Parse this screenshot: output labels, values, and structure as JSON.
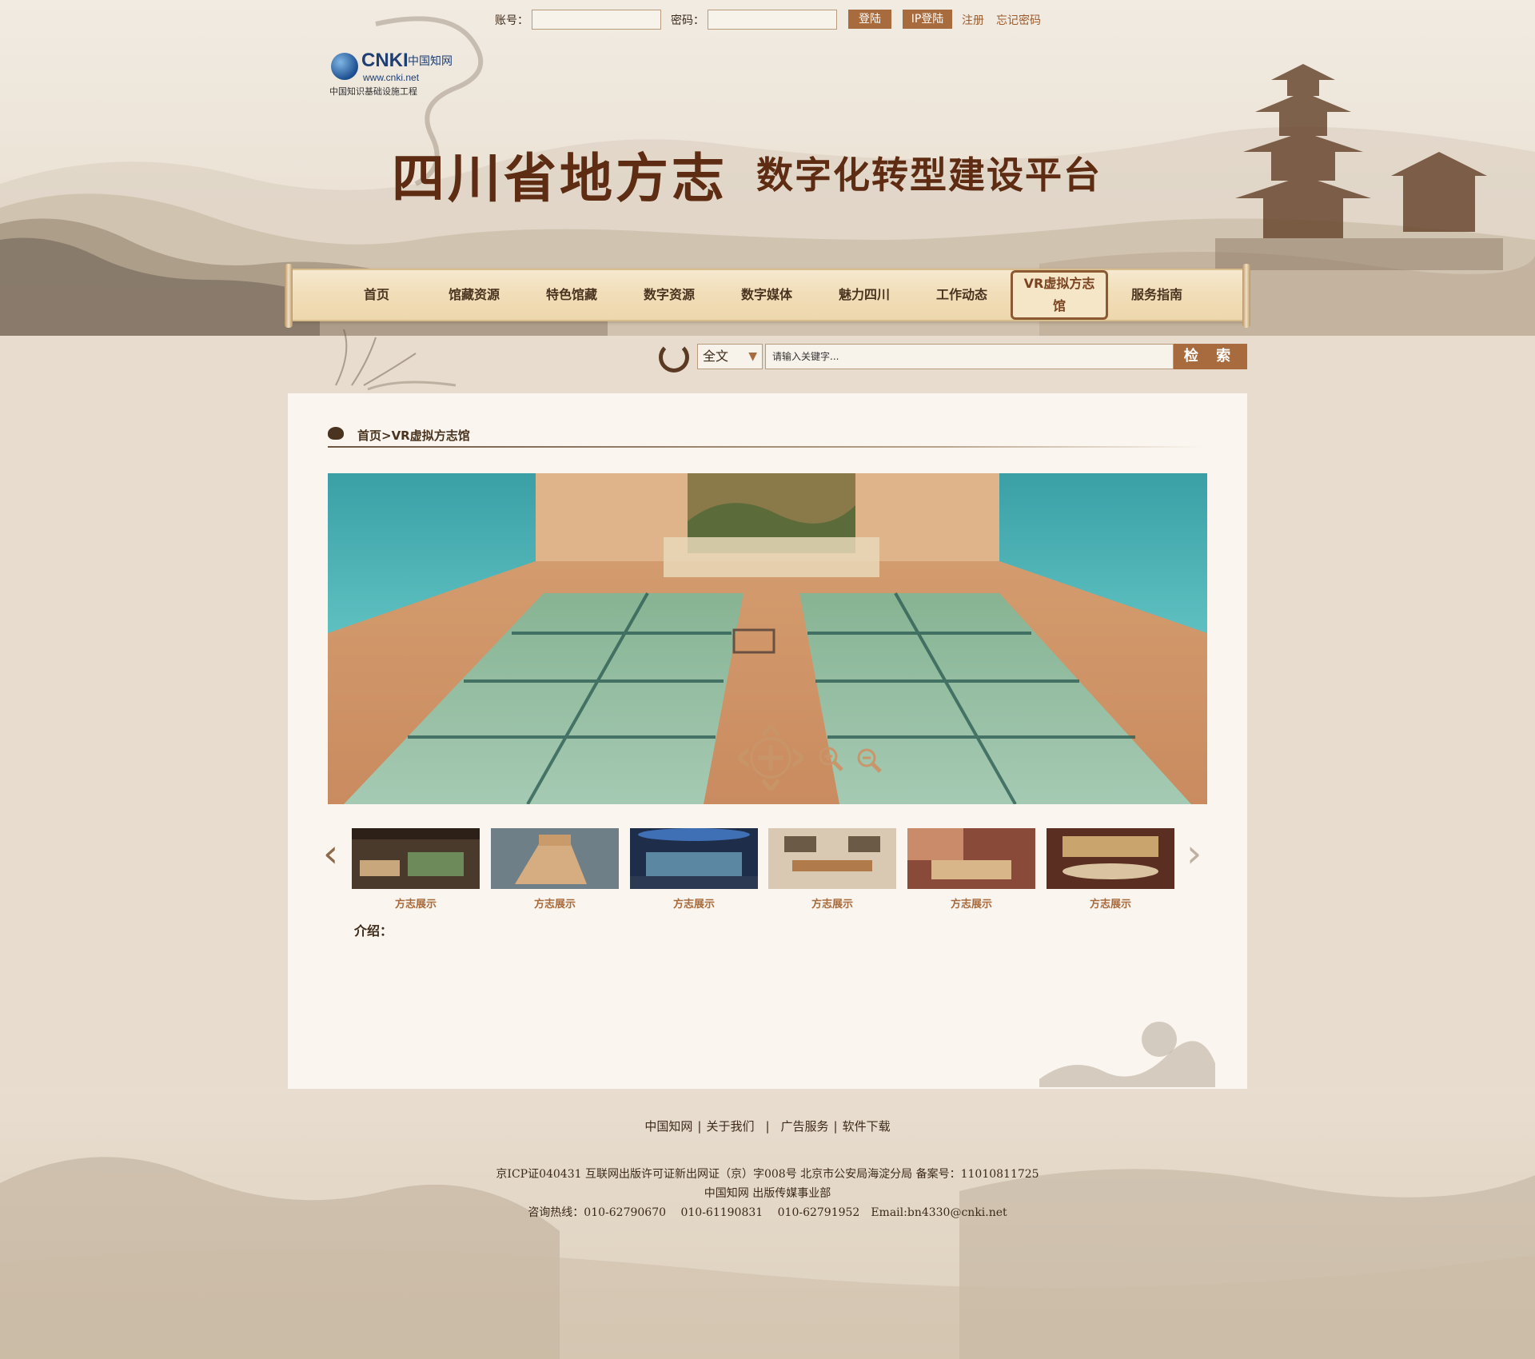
{
  "login": {
    "account_label": "账号：",
    "password_label": "密码：",
    "login_button": "登陆",
    "ip_login_button": "IP登陆",
    "register_link": "注册",
    "forgot_link": "忘记密码"
  },
  "logo": {
    "brand": "CNKI",
    "brand_cn": "中国知网",
    "url": "www.cnki.net",
    "subtitle": "中国知识基础设施工程"
  },
  "header": {
    "title_main": "四川省地方志",
    "title_sub": "数字化转型建设平台"
  },
  "nav": {
    "items": [
      {
        "label": "首页"
      },
      {
        "label": "馆藏资源"
      },
      {
        "label": "特色馆藏"
      },
      {
        "label": "数字资源"
      },
      {
        "label": "数字媒体"
      },
      {
        "label": "魅力四川"
      },
      {
        "label": "工作动态"
      },
      {
        "label": "VR虚拟方志馆"
      },
      {
        "label": "服务指南"
      }
    ],
    "active_index": 7
  },
  "search": {
    "scope": "全文",
    "placeholder": "请输入关键字...",
    "button": "检 索"
  },
  "breadcrumb": "首页>VR虚拟方志馆",
  "viewer": {
    "controls": [
      "move-icon",
      "zoom-in-icon",
      "zoom-out-icon"
    ]
  },
  "thumbnails": [
    {
      "caption": "方志展示"
    },
    {
      "caption": "方志展示"
    },
    {
      "caption": "方志展示"
    },
    {
      "caption": "方志展示"
    },
    {
      "caption": "方志展示"
    },
    {
      "caption": "方志展示"
    }
  ],
  "intro_label": "介绍：",
  "footer": {
    "links": [
      "中国知网",
      "关于我们",
      "广告服务",
      "软件下载"
    ],
    "icp": "京ICP证040431 互联网出版许可证新出网证（京）字008号 北京市公安局海淀分局 备案号：11010811725",
    "publisher": "中国知网 出版传媒事业部",
    "hotline": "咨询热线：010-62790670　 010-61190831　 010-62791952　Email:bn4330@cnki.net"
  }
}
